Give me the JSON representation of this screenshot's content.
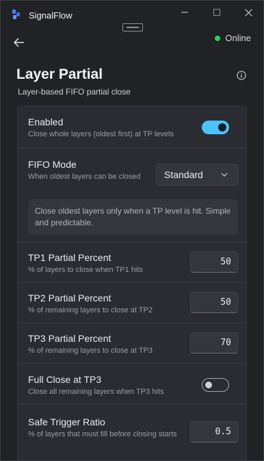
{
  "app": {
    "title": "SignalFlow"
  },
  "status": {
    "label": "Online",
    "color": "#2fcf5b"
  },
  "page": {
    "title": "Layer Partial",
    "subtitle": "Layer-based FIFO partial close"
  },
  "settings": {
    "enabled": {
      "title": "Enabled",
      "description": "Close whole layers (oldest first) at TP levels",
      "value": true
    },
    "fifo_mode": {
      "title": "FIFO Mode",
      "description": "When oldest layers can be closed",
      "selected": "Standard",
      "note": "Close oldest layers only when a TP level is hit. Simple and predictable."
    },
    "tp1": {
      "title": "TP1 Partial Percent",
      "description": "% of layers to close when TP1 hits",
      "value": "50"
    },
    "tp2": {
      "title": "TP2 Partial Percent",
      "description": "% of remaining layers to close at TP2",
      "value": "50"
    },
    "tp3": {
      "title": "TP3 Partial Percent",
      "description": "% of remaining layers to close at TP3",
      "value": "70"
    },
    "full_close_tp3": {
      "title": "Full Close at TP3",
      "description": "Close all remaining layers when TP3 hits",
      "value": false
    },
    "safe_trigger": {
      "title": "Safe Trigger Ratio",
      "description": "% of layers that must fill before closing starts",
      "value": "0.5"
    }
  },
  "colors": {
    "accent": "#4cc2ff",
    "background": "#202226",
    "card": "#2a2c31"
  },
  "icons": {
    "app_logo": "signalflow-logo-icon",
    "back": "arrow-left-icon",
    "info": "info-icon",
    "dropdown": "chevron-down-icon",
    "minimize": "minimize-icon",
    "maximize": "maximize-icon",
    "close": "close-icon"
  }
}
